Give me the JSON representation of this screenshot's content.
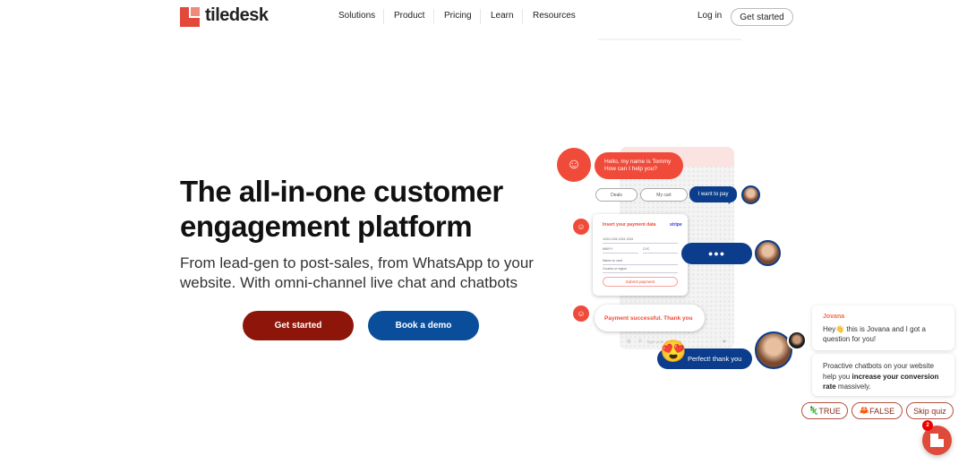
{
  "header": {
    "logo": "tiledesk",
    "nav": [
      "Solutions",
      "Product",
      "Pricing",
      "Learn",
      "Resources"
    ],
    "login": "Log in",
    "get_started": "Get started"
  },
  "hero": {
    "title": "The all-in-one customer engagement platform",
    "subtitle": "From lead-gen to post-sales, from WhatsApp to your website. With omni-channel live chat and chatbots",
    "cta_primary": "Get started",
    "cta_secondary": "Book a demo"
  },
  "demo": {
    "greeting": [
      "Hello, my name is Tommy",
      "How can I help you?"
    ],
    "options": [
      "Deals",
      "My cart",
      "I want to pay"
    ],
    "payment": {
      "title": "Insert your payment data",
      "brand": "stripe",
      "card_number": "1234 1234 1234 1234",
      "expiry": "MM/YY",
      "cvc": "CVC",
      "name": "Name on card",
      "country": "Country or region",
      "submit": "Submit payment"
    },
    "success": "Payment successful. Thank you",
    "input_placeholder": "Type your message",
    "reply": "Perfect! thank you"
  },
  "widget": {
    "agent": "Jovana",
    "msg1": "Hey👋 this is Jovana and I got a question for you!",
    "msg2_a": "Proactive chatbots on your website help you ",
    "msg2_b": "increase your conversion rate",
    "msg2_c": " massively.",
    "buttons": [
      "TRUE",
      "FALSE",
      "Skip quiz"
    ],
    "badge": "2"
  },
  "colors": {
    "brand": "#f04b3a",
    "primary_cta": "#8e1509",
    "secondary_cta": "#0a4e9b",
    "navy": "#0b3d8c"
  }
}
